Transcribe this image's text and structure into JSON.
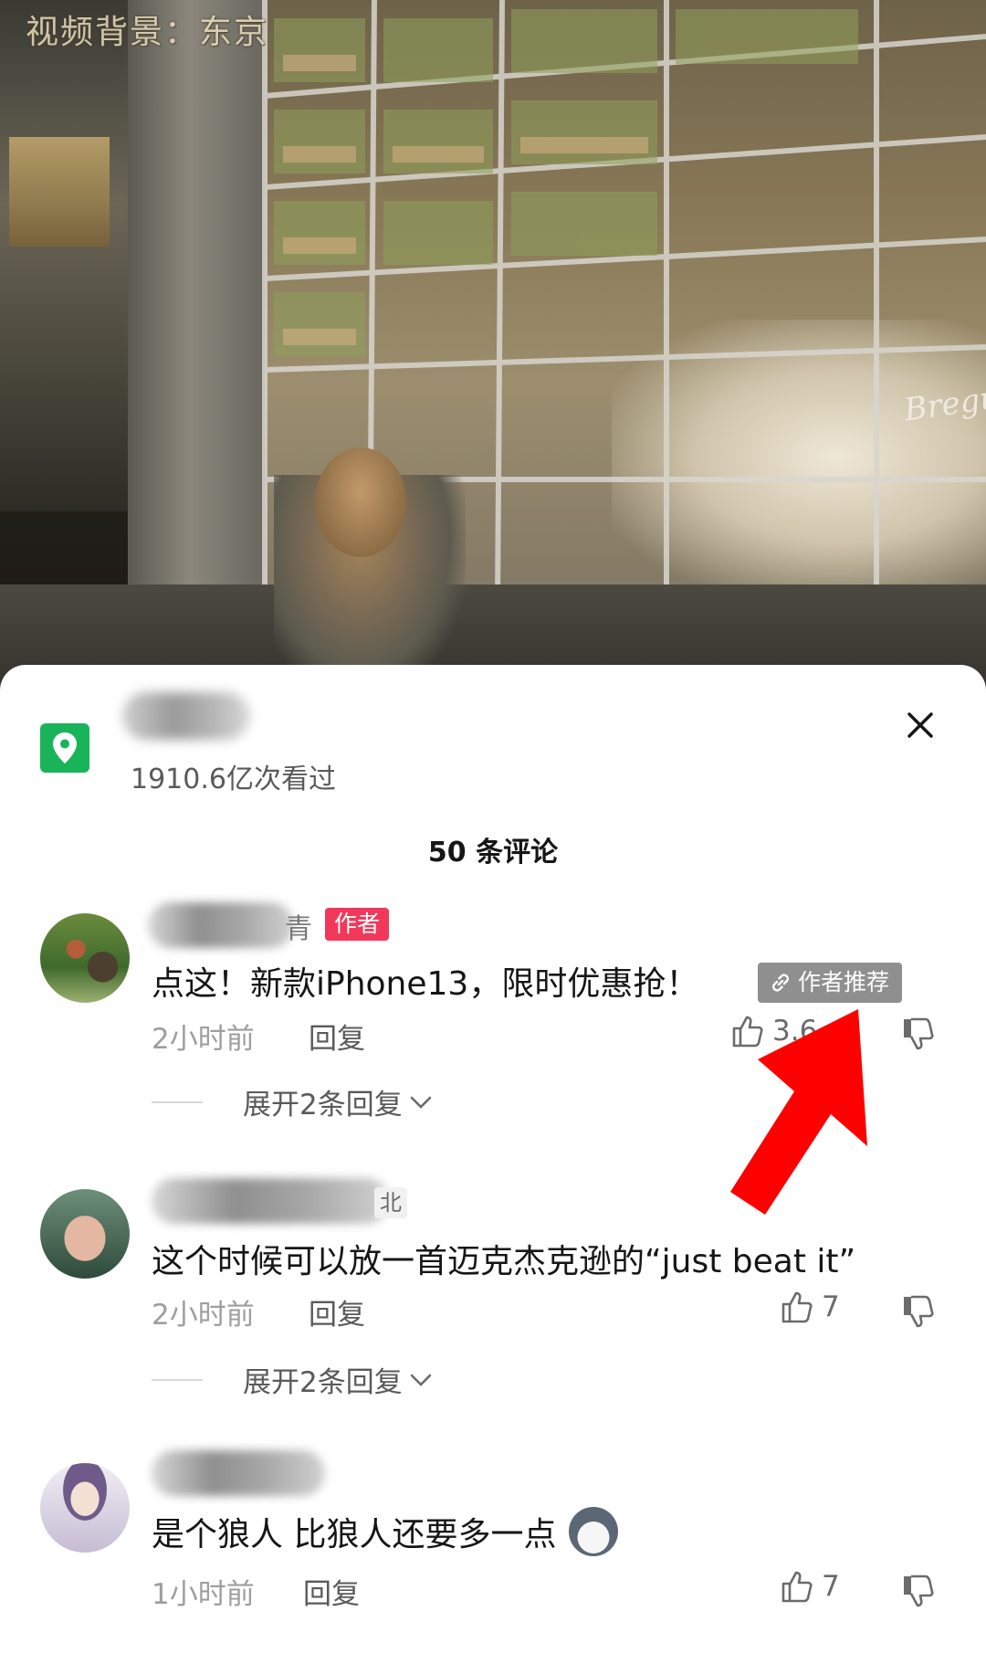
{
  "video": {
    "watermark": "视频背景：东京",
    "storefront_sign": "Breguet"
  },
  "location": {
    "views": "1910.6亿次看过"
  },
  "sheet": {
    "comment_count": "50 条评论"
  },
  "comments": [
    {
      "name_visible_tail": "青",
      "badge": "作者",
      "text": "点这！新款iPhone13，限时优惠抢！",
      "pinned_label": "作者推荐",
      "time": "2小时前",
      "reply_label": "回复",
      "likes": "3.6",
      "expand_label": "展开2条回复"
    },
    {
      "name_visible_tail": "北",
      "text": "这个时候可以放一首迈克杰克逊的“just beat it”",
      "time": "2小时前",
      "reply_label": "回复",
      "likes": "7",
      "expand_label": "展开2条回复"
    },
    {
      "text": "是个狼人  比狼人还要多一点",
      "time": "1小时前",
      "reply_label": "回复",
      "likes": "7"
    }
  ],
  "colors": {
    "author_badge": "#f2385a",
    "location_icon": "#19b45a",
    "annotation_arrow": "#ff0000"
  },
  "icons": [
    "location-pin-icon",
    "close-icon",
    "link-icon",
    "thumbs-up-icon",
    "thumbs-down-icon",
    "chevron-down-icon",
    "wolf-emoji"
  ]
}
